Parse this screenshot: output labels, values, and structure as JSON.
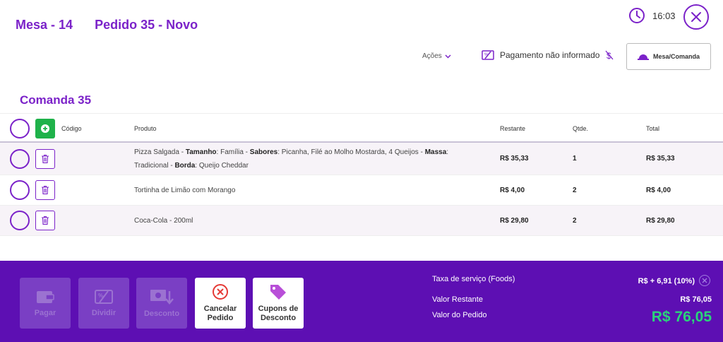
{
  "header": {
    "mesa": "Mesa - 14",
    "pedido": "Pedido 35 - Novo",
    "time": "16:03"
  },
  "toolbar": {
    "acoes": "Ações",
    "pagamento": "Pagamento não informado",
    "mesa_comanda": "Mesa/Comanda"
  },
  "comanda_title": "Comanda 35",
  "table": {
    "headers": {
      "codigo": "Código",
      "produto": "Produto",
      "restante": "Restante",
      "qtde": "Qtde.",
      "total": "Total"
    },
    "rows": [
      {
        "produto_parts": [
          "Pizza Salgada - ",
          "Tamanho",
          ": Família - ",
          "Sabores",
          ": Picanha, Filé ao Molho Mostarda, 4 Queijos - ",
          "Massa",
          ": Tradicional - ",
          "Borda",
          ": Queijo Cheddar"
        ],
        "restante": "R$ 35,33",
        "qtde": "1",
        "total": "R$ 35,33"
      },
      {
        "produto": "Tortinha de Limão com Morango",
        "restante": "R$ 4,00",
        "qtde": "2",
        "total": "R$ 4,00"
      },
      {
        "produto": "Coca-Cola - 200ml",
        "restante": "R$ 29,80",
        "qtde": "2",
        "total": "R$ 29,80"
      }
    ]
  },
  "footer": {
    "buttons": {
      "pagar": "Pagar",
      "dividir": "Dividir",
      "desconto": "Desconto",
      "cancelar_1": "Cancelar",
      "cancelar_2": "Pedido",
      "cupons_1": "Cupons de",
      "cupons_2": "Desconto"
    },
    "taxa_label": "Taxa de serviço (Foods)",
    "taxa_value": "R$ + 6,91 (10%)",
    "restante_label": "Valor Restante",
    "restante_value": "R$ 76,05",
    "pedido_label": "Valor do Pedido",
    "pedido_value": "R$ 76,05"
  },
  "colors": {
    "accent": "#7b22c9",
    "footer_bg": "#5d0fb3",
    "success": "#2ad47a",
    "add": "#1fb24a",
    "danger": "#e53935",
    "coupon": "#b84fd8"
  }
}
